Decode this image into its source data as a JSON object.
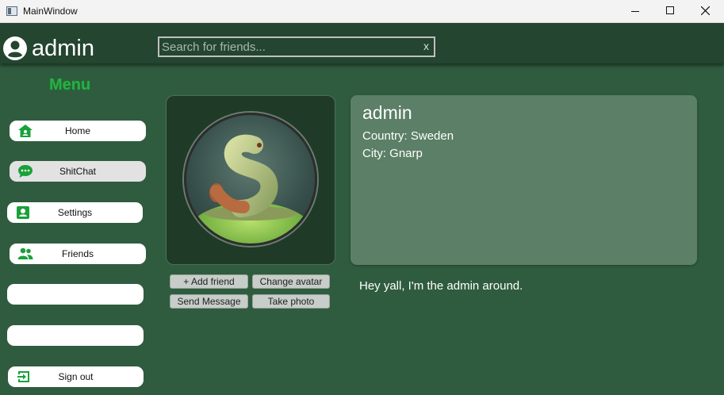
{
  "window": {
    "title": "MainWindow"
  },
  "header": {
    "username": "admin",
    "search_placeholder": "Search for friends...",
    "search_value": "",
    "clear_label": "x"
  },
  "menu": {
    "title": "Menu",
    "items": [
      {
        "label": "Home",
        "icon": "home-icon"
      },
      {
        "label": "ShitChat",
        "icon": "chat-icon"
      },
      {
        "label": "Settings",
        "icon": "contact-card-icon"
      },
      {
        "label": "Friends",
        "icon": "people-icon"
      },
      {
        "label": ""
      },
      {
        "label": ""
      },
      {
        "label": "Sign out",
        "icon": "sign-out-icon"
      }
    ]
  },
  "profile": {
    "name": "admin",
    "country": "Country: Sweden",
    "city": "City: Gnarp",
    "bio": "Hey yall, I'm the admin around."
  },
  "actions": {
    "add_friend": "+ Add friend",
    "change_avatar": "Change avatar",
    "send_message": "Send Message",
    "take_photo": "Take photo"
  },
  "colors": {
    "background": "#2f5c3f",
    "header": "#24452f",
    "accent_green": "#27b043",
    "info_panel": "#5b7f67"
  }
}
